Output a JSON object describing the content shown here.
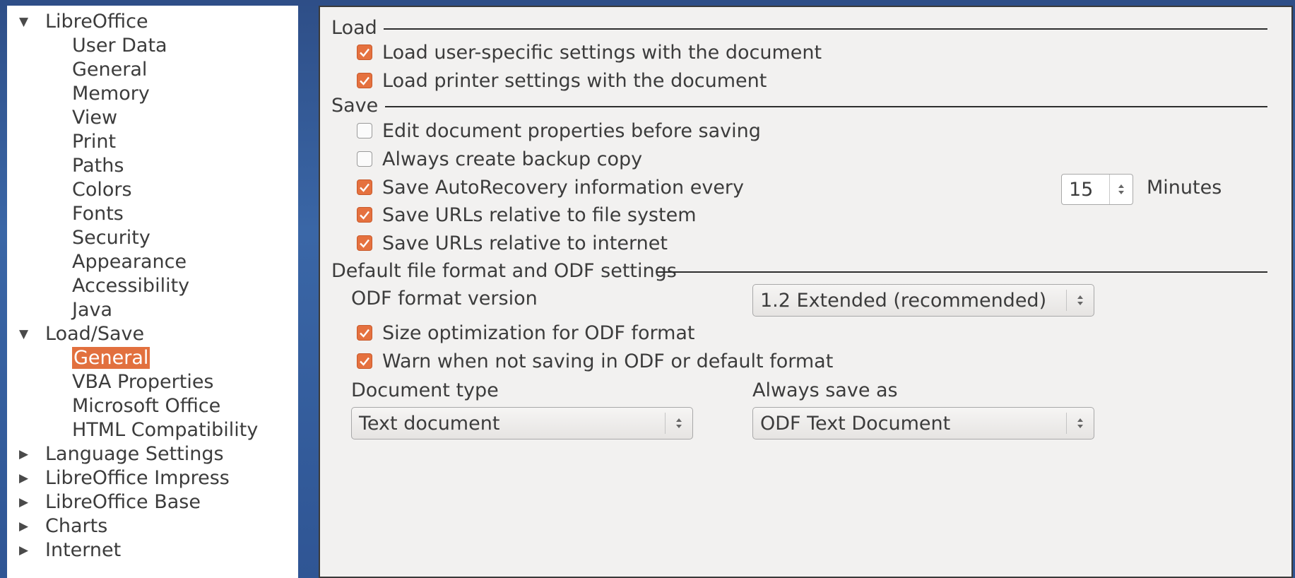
{
  "tree": {
    "items": [
      {
        "label": "LibreOffice",
        "level": 0,
        "arrow": "▼"
      },
      {
        "label": "User Data",
        "level": 1
      },
      {
        "label": "General",
        "level": 1
      },
      {
        "label": "Memory",
        "level": 1
      },
      {
        "label": "View",
        "level": 1
      },
      {
        "label": "Print",
        "level": 1
      },
      {
        "label": "Paths",
        "level": 1
      },
      {
        "label": "Colors",
        "level": 1
      },
      {
        "label": "Fonts",
        "level": 1
      },
      {
        "label": "Security",
        "level": 1
      },
      {
        "label": "Appearance",
        "level": 1
      },
      {
        "label": "Accessibility",
        "level": 1
      },
      {
        "label": "Java",
        "level": 1
      },
      {
        "label": "Load/Save",
        "level": 0,
        "arrow": "▼"
      },
      {
        "label": "General",
        "level": 1,
        "selected": true
      },
      {
        "label": "VBA Properties",
        "level": 1
      },
      {
        "label": "Microsoft Office",
        "level": 1
      },
      {
        "label": "HTML Compatibility",
        "level": 1
      },
      {
        "label": "Language Settings",
        "level": 0,
        "arrow": "▶"
      },
      {
        "label": "LibreOffice Impress",
        "level": 0,
        "arrow": "▶"
      },
      {
        "label": "LibreOffice Base",
        "level": 0,
        "arrow": "▶"
      },
      {
        "label": "Charts",
        "level": 0,
        "arrow": "▶"
      },
      {
        "label": "Internet",
        "level": 0,
        "arrow": "▶"
      }
    ]
  },
  "load": {
    "title": "Load",
    "user_settings": "Load user-specific settings with the document",
    "printer_settings": "Load printer settings with the document"
  },
  "save": {
    "title": "Save",
    "edit_props": "Edit document properties before saving",
    "backup": "Always create backup copy",
    "autorecovery": "Save AutoRecovery information every",
    "autorecovery_minutes": "15",
    "minutes_label": "Minutes",
    "urls_fs": "Save URLs relative to file system",
    "urls_internet": "Save URLs relative to internet"
  },
  "format": {
    "title": "Default file format and ODF settings",
    "odf_version_label": "ODF format version",
    "odf_version_value": "1.2 Extended (recommended)",
    "size_opt": "Size optimization for ODF format",
    "warn": "Warn when not saving in ODF or default format",
    "doc_type_label": "Document type",
    "doc_type_value": "Text document",
    "save_as_label": "Always save as",
    "save_as_value": "ODF Text Document"
  },
  "colors": {
    "accent": "#e5713f",
    "selection": "#e2703e"
  }
}
